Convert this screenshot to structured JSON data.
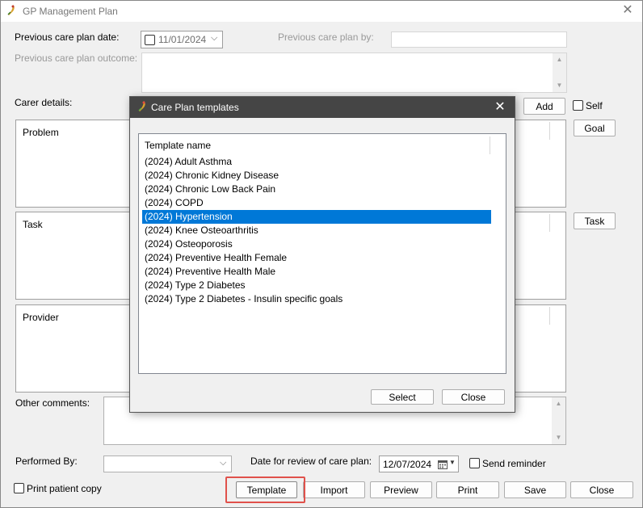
{
  "window": {
    "title": "GP Management Plan"
  },
  "form": {
    "prev_care_plan_date_label": "Previous care plan date:",
    "prev_care_plan_date_value": "11/01/2024",
    "prev_care_plan_by_label": "Previous care plan by:",
    "prev_care_plan_outcome_label": "Previous care plan outcome:",
    "carer_details_label": "Carer details:",
    "add_label": "Add",
    "self_label": "Self",
    "problem_label": "Problem",
    "goal_label": "Goal",
    "task_label": "Task",
    "task_button_label": "Task",
    "provider_label": "Provider",
    "other_comments_label": "Other comments:",
    "performed_by_label": "Performed By:",
    "review_date_label": "Date for review of care plan:",
    "review_date_value": "12/07/2024",
    "send_reminder_label": "Send reminder",
    "print_patient_copy_label": "Print patient copy"
  },
  "buttons": {
    "template": "Template",
    "import": "Import",
    "preview": "Preview",
    "print": "Print",
    "save": "Save",
    "close": "Close"
  },
  "dialog": {
    "title": "Care Plan templates",
    "column_header": "Template name",
    "items": [
      "(2024) Adult Asthma",
      "(2024) Chronic Kidney Disease",
      "(2024) Chronic Low Back Pain",
      "(2024) COPD",
      "(2024) Hypertension",
      "(2024) Knee Osteoarthritis",
      "(2024) Osteoporosis",
      "(2024) Preventive Health Female",
      "(2024) Preventive Health Male",
      "(2024) Type 2 Diabetes",
      "(2024) Type 2 Diabetes - Insulin specific goals"
    ],
    "selected_index": 4,
    "select_label": "Select",
    "close_label": "Close"
  },
  "icons": {
    "app": "app-feather-icon",
    "close": "close-icon",
    "dropdown": "chevron-down-icon",
    "calendar": "calendar-icon"
  },
  "colors": {
    "selection": "#0078d7",
    "dialog_title_bg": "#454545",
    "highlight": "#e0514b"
  }
}
